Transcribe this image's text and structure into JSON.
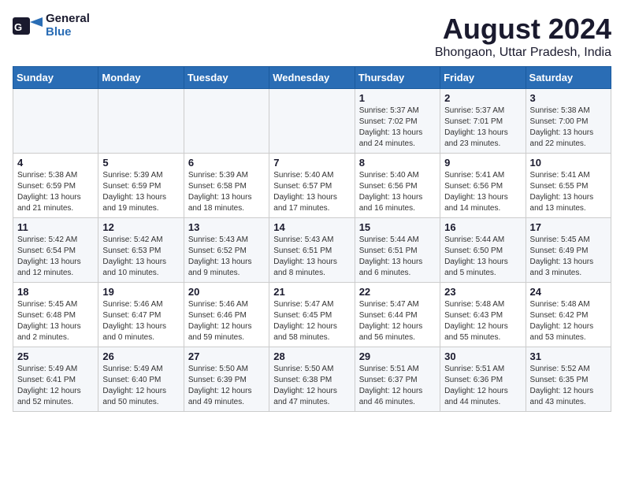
{
  "header": {
    "logo_line1": "General",
    "logo_line2": "Blue",
    "month_year": "August 2024",
    "location": "Bhongaon, Uttar Pradesh, India"
  },
  "weekdays": [
    "Sunday",
    "Monday",
    "Tuesday",
    "Wednesday",
    "Thursday",
    "Friday",
    "Saturday"
  ],
  "weeks": [
    [
      {
        "day": "",
        "info": ""
      },
      {
        "day": "",
        "info": ""
      },
      {
        "day": "",
        "info": ""
      },
      {
        "day": "",
        "info": ""
      },
      {
        "day": "1",
        "info": "Sunrise: 5:37 AM\nSunset: 7:02 PM\nDaylight: 13 hours\nand 24 minutes."
      },
      {
        "day": "2",
        "info": "Sunrise: 5:37 AM\nSunset: 7:01 PM\nDaylight: 13 hours\nand 23 minutes."
      },
      {
        "day": "3",
        "info": "Sunrise: 5:38 AM\nSunset: 7:00 PM\nDaylight: 13 hours\nand 22 minutes."
      }
    ],
    [
      {
        "day": "4",
        "info": "Sunrise: 5:38 AM\nSunset: 6:59 PM\nDaylight: 13 hours\nand 21 minutes."
      },
      {
        "day": "5",
        "info": "Sunrise: 5:39 AM\nSunset: 6:59 PM\nDaylight: 13 hours\nand 19 minutes."
      },
      {
        "day": "6",
        "info": "Sunrise: 5:39 AM\nSunset: 6:58 PM\nDaylight: 13 hours\nand 18 minutes."
      },
      {
        "day": "7",
        "info": "Sunrise: 5:40 AM\nSunset: 6:57 PM\nDaylight: 13 hours\nand 17 minutes."
      },
      {
        "day": "8",
        "info": "Sunrise: 5:40 AM\nSunset: 6:56 PM\nDaylight: 13 hours\nand 16 minutes."
      },
      {
        "day": "9",
        "info": "Sunrise: 5:41 AM\nSunset: 6:56 PM\nDaylight: 13 hours\nand 14 minutes."
      },
      {
        "day": "10",
        "info": "Sunrise: 5:41 AM\nSunset: 6:55 PM\nDaylight: 13 hours\nand 13 minutes."
      }
    ],
    [
      {
        "day": "11",
        "info": "Sunrise: 5:42 AM\nSunset: 6:54 PM\nDaylight: 13 hours\nand 12 minutes."
      },
      {
        "day": "12",
        "info": "Sunrise: 5:42 AM\nSunset: 6:53 PM\nDaylight: 13 hours\nand 10 minutes."
      },
      {
        "day": "13",
        "info": "Sunrise: 5:43 AM\nSunset: 6:52 PM\nDaylight: 13 hours\nand 9 minutes."
      },
      {
        "day": "14",
        "info": "Sunrise: 5:43 AM\nSunset: 6:51 PM\nDaylight: 13 hours\nand 8 minutes."
      },
      {
        "day": "15",
        "info": "Sunrise: 5:44 AM\nSunset: 6:51 PM\nDaylight: 13 hours\nand 6 minutes."
      },
      {
        "day": "16",
        "info": "Sunrise: 5:44 AM\nSunset: 6:50 PM\nDaylight: 13 hours\nand 5 minutes."
      },
      {
        "day": "17",
        "info": "Sunrise: 5:45 AM\nSunset: 6:49 PM\nDaylight: 13 hours\nand 3 minutes."
      }
    ],
    [
      {
        "day": "18",
        "info": "Sunrise: 5:45 AM\nSunset: 6:48 PM\nDaylight: 13 hours\nand 2 minutes."
      },
      {
        "day": "19",
        "info": "Sunrise: 5:46 AM\nSunset: 6:47 PM\nDaylight: 13 hours\nand 0 minutes."
      },
      {
        "day": "20",
        "info": "Sunrise: 5:46 AM\nSunset: 6:46 PM\nDaylight: 12 hours\nand 59 minutes."
      },
      {
        "day": "21",
        "info": "Sunrise: 5:47 AM\nSunset: 6:45 PM\nDaylight: 12 hours\nand 58 minutes."
      },
      {
        "day": "22",
        "info": "Sunrise: 5:47 AM\nSunset: 6:44 PM\nDaylight: 12 hours\nand 56 minutes."
      },
      {
        "day": "23",
        "info": "Sunrise: 5:48 AM\nSunset: 6:43 PM\nDaylight: 12 hours\nand 55 minutes."
      },
      {
        "day": "24",
        "info": "Sunrise: 5:48 AM\nSunset: 6:42 PM\nDaylight: 12 hours\nand 53 minutes."
      }
    ],
    [
      {
        "day": "25",
        "info": "Sunrise: 5:49 AM\nSunset: 6:41 PM\nDaylight: 12 hours\nand 52 minutes."
      },
      {
        "day": "26",
        "info": "Sunrise: 5:49 AM\nSunset: 6:40 PM\nDaylight: 12 hours\nand 50 minutes."
      },
      {
        "day": "27",
        "info": "Sunrise: 5:50 AM\nSunset: 6:39 PM\nDaylight: 12 hours\nand 49 minutes."
      },
      {
        "day": "28",
        "info": "Sunrise: 5:50 AM\nSunset: 6:38 PM\nDaylight: 12 hours\nand 47 minutes."
      },
      {
        "day": "29",
        "info": "Sunrise: 5:51 AM\nSunset: 6:37 PM\nDaylight: 12 hours\nand 46 minutes."
      },
      {
        "day": "30",
        "info": "Sunrise: 5:51 AM\nSunset: 6:36 PM\nDaylight: 12 hours\nand 44 minutes."
      },
      {
        "day": "31",
        "info": "Sunrise: 5:52 AM\nSunset: 6:35 PM\nDaylight: 12 hours\nand 43 minutes."
      }
    ]
  ]
}
